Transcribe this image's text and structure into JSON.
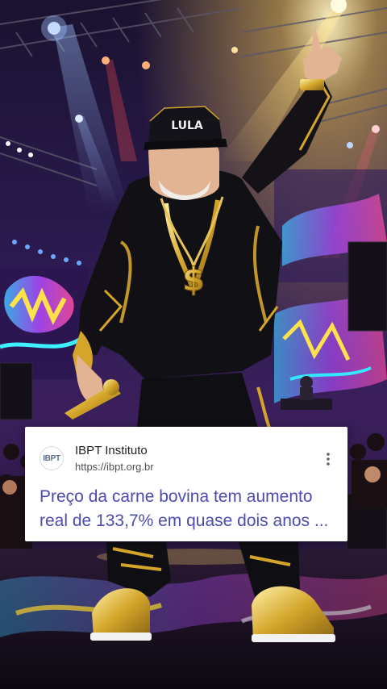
{
  "card": {
    "favicon_text": "IBPT",
    "site_name": "IBPT Instituto",
    "site_url": "https://ibpt.org.br",
    "headline": "Preço da carne bovina tem aumento real de 133,7% em quase dois anos ..."
  },
  "image": {
    "cap_text": "LULA",
    "pendant_text": "$"
  },
  "icons": {
    "more": "more-vertical-icon"
  },
  "colors": {
    "headline": "#4b4bb0",
    "card_background": "#ffffff",
    "gold": "#d4a52a",
    "stage_purple": "#3a1d6e"
  }
}
